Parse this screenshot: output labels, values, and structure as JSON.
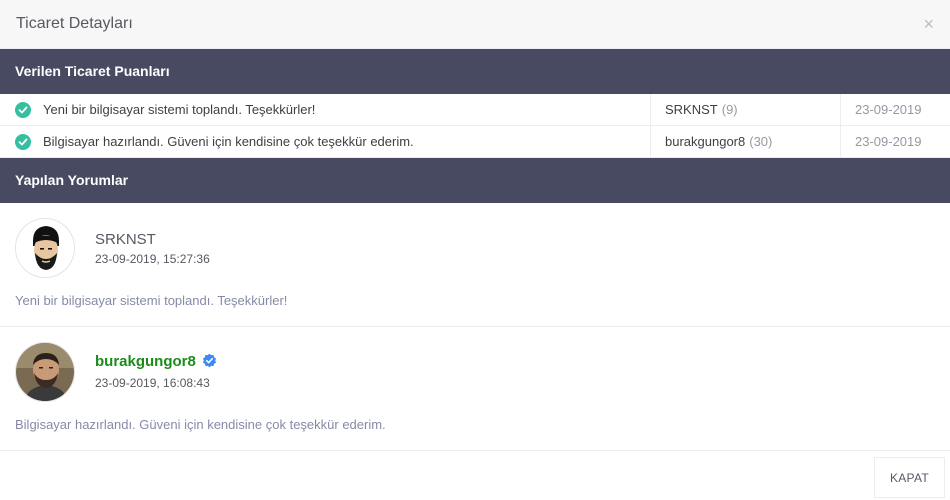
{
  "modal": {
    "title": "Ticaret Detayları",
    "close_symbol": "×"
  },
  "ratings": {
    "section_title": "Verilen Ticaret Puanları",
    "rows": [
      {
        "message": "Yeni bir bilgisayar sistemi toplandı. Teşekkürler!",
        "user": "SRKNST",
        "count": "(9)",
        "date": "23-09-2019",
        "icon": "check-circle-icon"
      },
      {
        "message": "Bilgisayar hazırlandı. Güveni için kendisine çok teşekkür ederim.",
        "user": "burakgungor8",
        "count": "(30)",
        "date": "23-09-2019",
        "icon": "check-circle-icon"
      }
    ]
  },
  "comments": {
    "section_title": "Yapılan Yorumlar",
    "items": [
      {
        "name": "SRKNST",
        "date": "23-09-2019, 15:27:36",
        "text": "Yeni bir bilgisayar sistemi toplandı. Teşekkürler!",
        "verified": false
      },
      {
        "name": "burakgungor8",
        "date": "23-09-2019, 16:08:43",
        "text": "Bilgisayar hazırlandı. Güveni için kendisine çok teşekkür ederim.",
        "verified": true,
        "badge_icon": "verified-badge-icon"
      }
    ]
  },
  "footer": {
    "close_label": "KAPAT"
  },
  "colors": {
    "section_bg": "#474a61",
    "check": "#34bfa3",
    "verified_name": "#1a8c1a",
    "badge": "#3d8af7"
  }
}
